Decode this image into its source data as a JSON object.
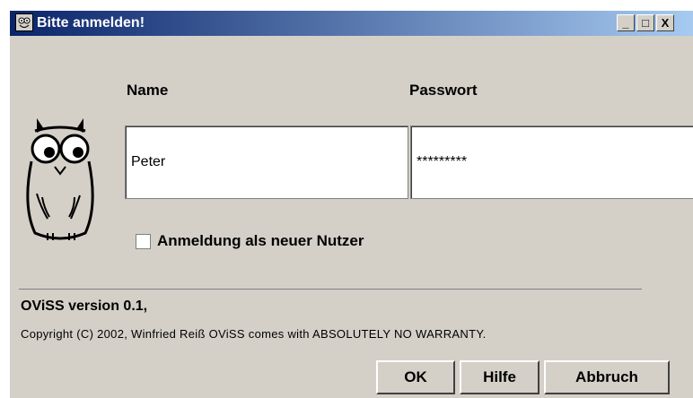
{
  "window": {
    "title": "Bitte anmelden!",
    "min_label": "_",
    "max_label": "□",
    "close_label": "X"
  },
  "form": {
    "name_label": "Name",
    "password_label": "Passwort",
    "name_value": "Peter",
    "password_value": "*********",
    "new_user_label": "Anmeldung als neuer Nutzer",
    "new_user_checked": false
  },
  "info": {
    "version": "OViSS version 0.1,",
    "copyright": "Copyright (C) 2002, Winfried Reiß OViSS comes with ABSOLUTELY NO WARRANTY."
  },
  "buttons": {
    "ok": "OK",
    "help": "Hilfe",
    "cancel": "Abbruch"
  },
  "colors": {
    "titlebar_start": "#0a246a",
    "titlebar_end": "#a6caf0",
    "window_bg": "#d4d0c8"
  },
  "icons": {
    "title": "owl-icon",
    "mascot": "owl-mascot-icon"
  }
}
